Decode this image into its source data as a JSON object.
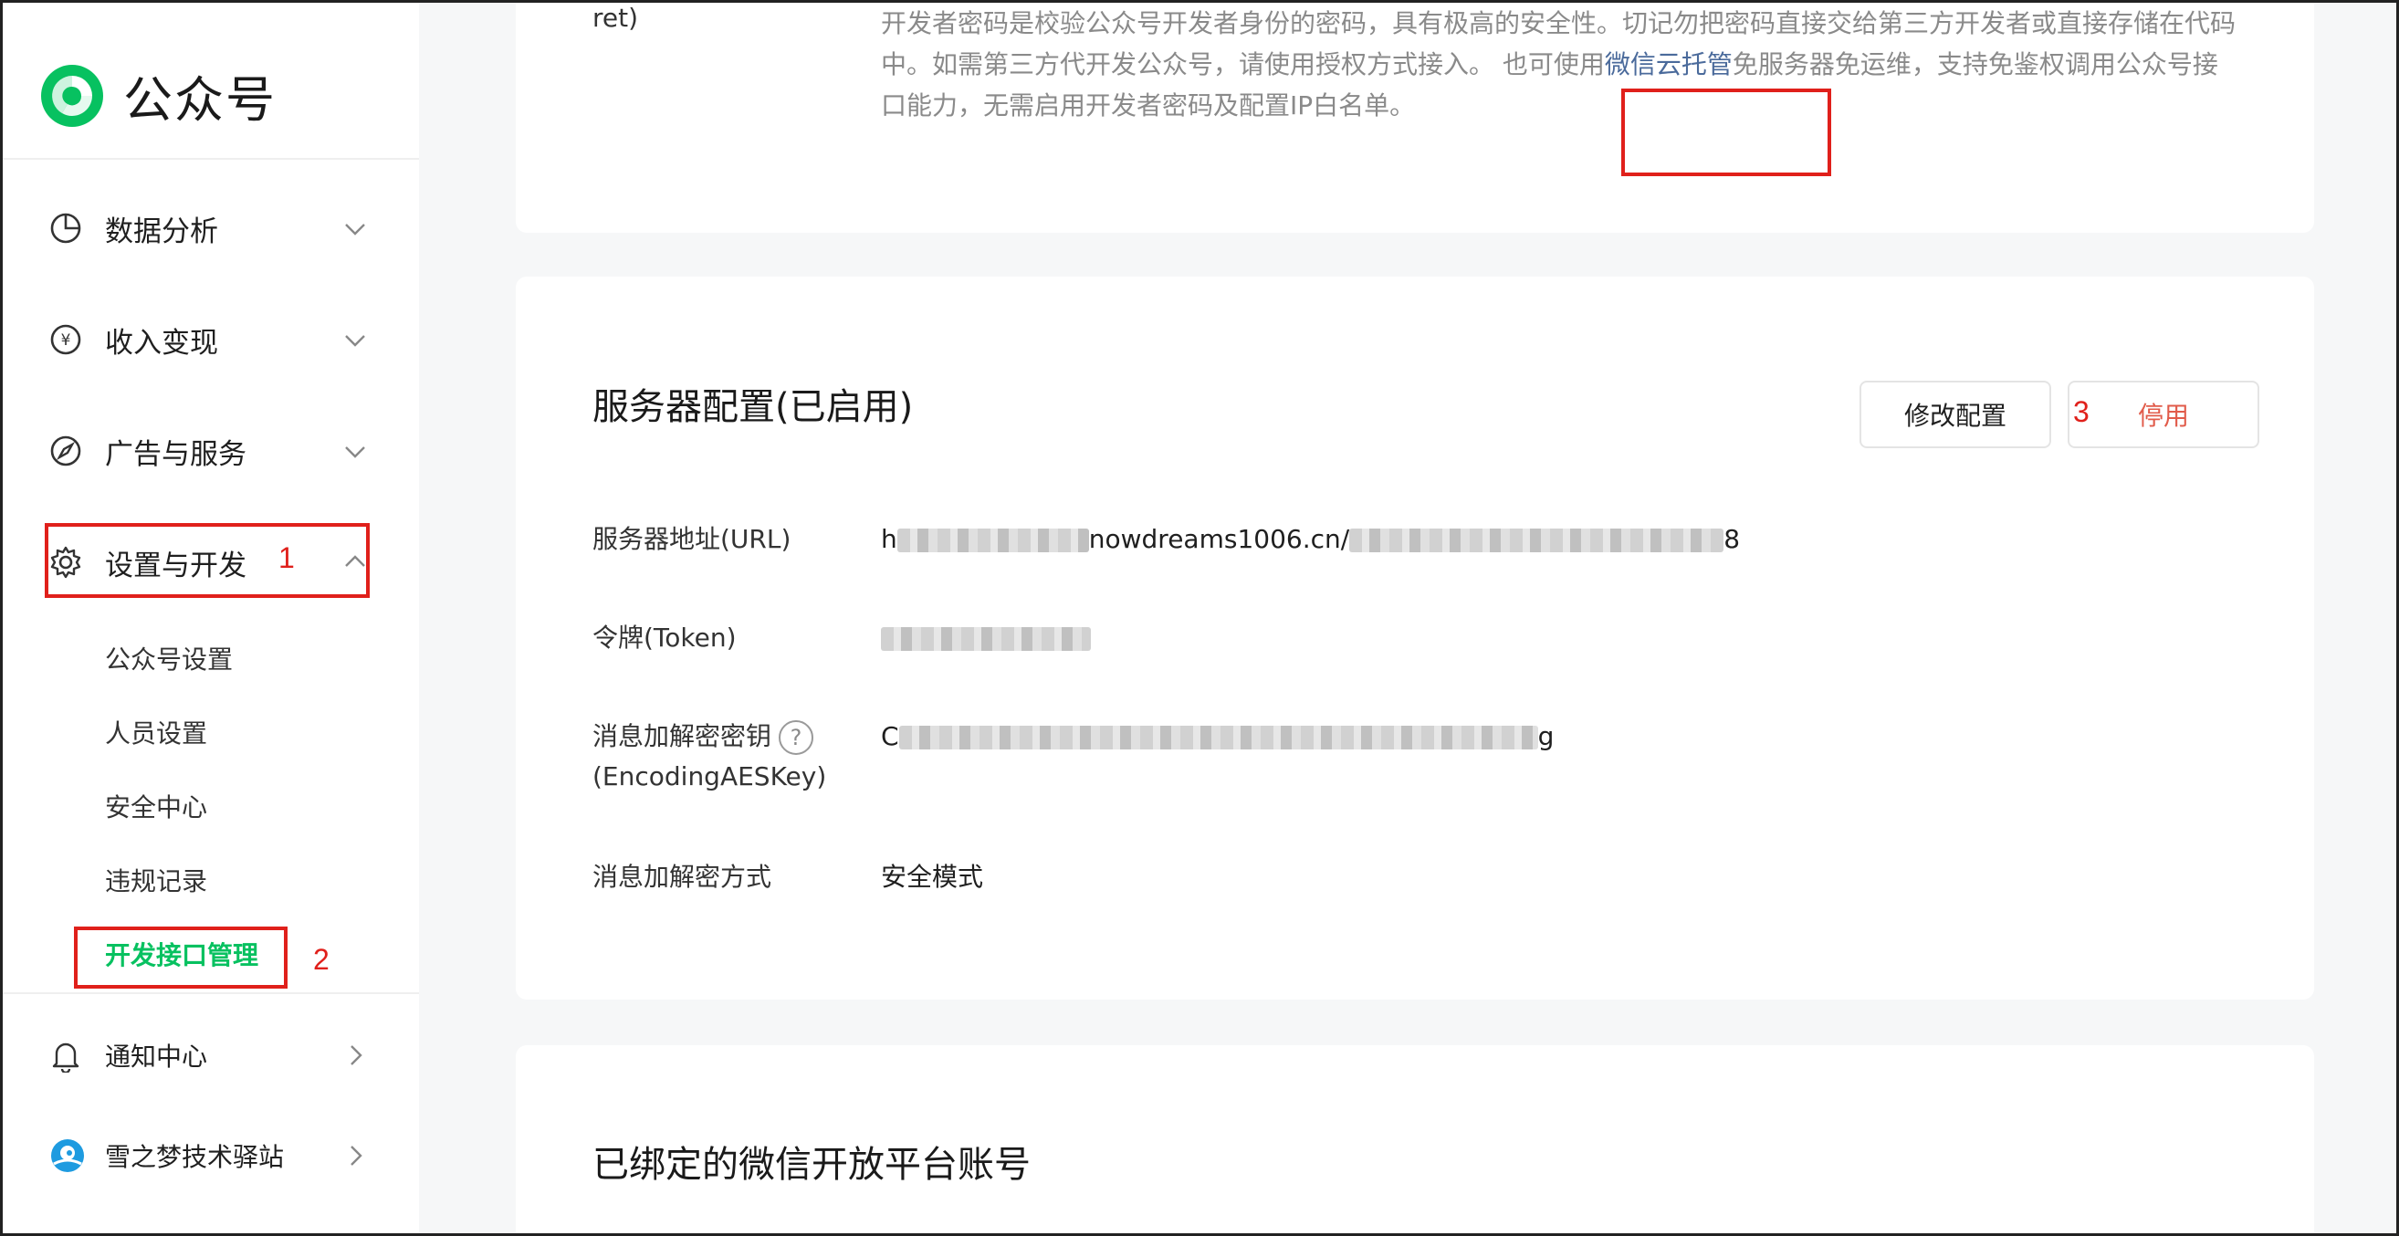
{
  "sidebar": {
    "logo_text": "公众号",
    "nav": [
      {
        "label": "数据分析",
        "icon": "chart-pie-icon"
      },
      {
        "label": "收入变现",
        "icon": "yen-coin-icon"
      },
      {
        "label": "广告与服务",
        "icon": "compass-icon"
      },
      {
        "label": "设置与开发",
        "icon": "gear-icon"
      }
    ],
    "sub_items": [
      "公众号设置",
      "人员设置",
      "安全中心",
      "违规记录",
      "开发接口管理"
    ],
    "bottom": [
      {
        "label": "通知中心",
        "icon": "bell-icon"
      },
      {
        "label": "雪之梦技术驿站",
        "icon": "account-avatar-icon"
      }
    ]
  },
  "annotations": {
    "n1": "1",
    "n2": "2",
    "n3": "3"
  },
  "main": {
    "top_card": {
      "label_tail": "ret)",
      "desc_part1": "开发者密码是校验公众号开发者身份的密码，具有极高的安全性。切记勿把密码直接交给第三方开发者或直接存储在代码中。如需第三方代开发公众号，请使用授权方式接入。 也可使用",
      "desc_link": "微信云托管",
      "desc_part2": "免服务器免运维，支持免鉴权调用公众号接口能力，无需启用开发者密码及配置IP白名单。"
    },
    "server_config": {
      "title": "服务器配置(已启用)",
      "edit_button": "修改配置",
      "stop_button": "停用",
      "url_label": "服务器地址(URL)",
      "url_prefix": "h",
      "url_visible": "nowdreams1006.cn/",
      "url_suffix": "8",
      "token_label": "令牌(Token)",
      "aes_label_1": "消息加解密密钥",
      "aes_label_2": "(EncodingAESKey)",
      "aes_prefix": "C",
      "aes_suffix": "g",
      "mode_label": "消息加解密方式",
      "mode_value": "安全模式"
    },
    "bound_card": {
      "title": "已绑定的微信开放平台账号"
    }
  },
  "colors": {
    "accent_green": "#07c160",
    "annotation_red": "#e0201b",
    "stop_text": "#e15b4a",
    "link_blue": "#4a6a9b"
  }
}
